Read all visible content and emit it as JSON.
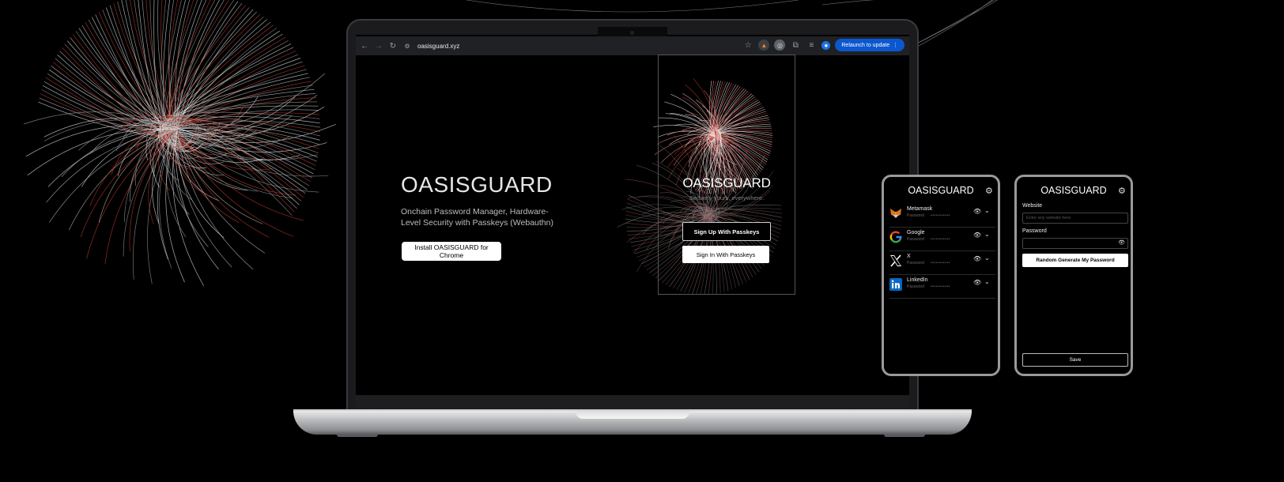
{
  "browser": {
    "url": "oasisguard.xyz",
    "relaunch_label": "Relaunch to update",
    "icons": [
      "back-arrow-icon",
      "forward-arrow-icon",
      "reload-icon",
      "site-settings-icon",
      "bookmark-star-icon",
      "metamask-extension-icon",
      "extension-icon",
      "puzzle-icon",
      "reading-list-icon",
      "profile-avatar-icon",
      "kebab-menu-icon"
    ]
  },
  "landing": {
    "title": "OASISGUARD",
    "subtitle": "Onchain Password Manager, Hardware-Level Security with Passkeys (Webauthn)",
    "install_button": "Install OASISGUARD for Chrome"
  },
  "popup": {
    "title": "OASISGUARD",
    "tagline": "Securely yours, everywhere.",
    "signup_button": "Sign Up With Passkeys",
    "signin_button": "Sign In With Passkeys"
  },
  "phone_list": {
    "title": "OASISGUARD",
    "entries": [
      {
        "name": "Metamask",
        "label": "Password",
        "mask": "•••••••••••",
        "icon": "metamask-fox-icon"
      },
      {
        "name": "Google",
        "label": "Password",
        "mask": "•••••••••••",
        "icon": "google-g-icon"
      },
      {
        "name": "X",
        "label": "Password",
        "mask": "•••••••••••",
        "icon": "x-logo-icon"
      },
      {
        "name": "LinkedIn",
        "label": "Password",
        "mask": "•••••••••••",
        "icon": "linkedin-icon"
      }
    ]
  },
  "phone_form": {
    "title": "OASISGUARD",
    "website_label": "Website",
    "website_placeholder": "Enter any website here",
    "password_label": "Password",
    "generate_button": "Random Generate My Password",
    "save_button": "Save"
  },
  "colors": {
    "background": "#000000",
    "accent_blue": "#0b57d0",
    "line_red": "#c0392b",
    "line_white": "#e6e6e6"
  }
}
